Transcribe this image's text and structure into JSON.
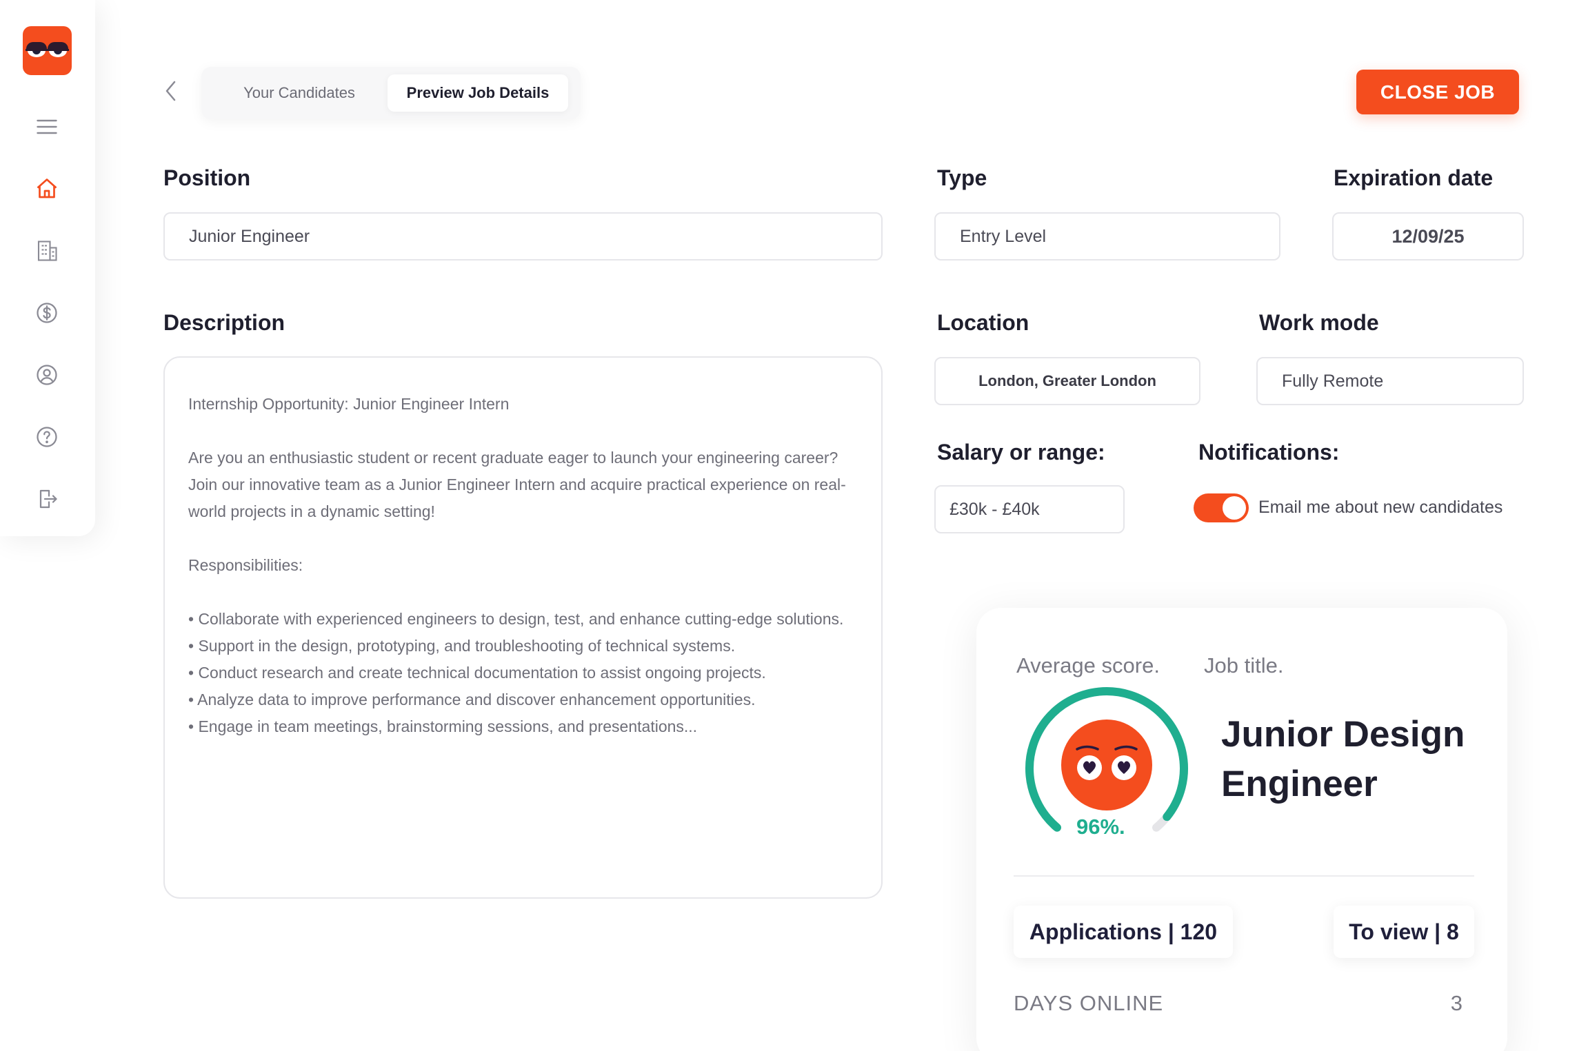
{
  "colors": {
    "accent": "#f44d1e",
    "score": "#1fae8f",
    "text": "#1f1f2e",
    "muted": "#7a7a84"
  },
  "sidebar": {
    "logo": "owl-eyes-logo",
    "items": [
      {
        "icon": "menu-icon"
      },
      {
        "icon": "home-icon",
        "active": true
      },
      {
        "icon": "building-icon"
      },
      {
        "icon": "dollar-icon"
      },
      {
        "icon": "user-circle-icon"
      },
      {
        "icon": "help-icon"
      },
      {
        "icon": "logout-icon"
      }
    ]
  },
  "header": {
    "tabs": [
      {
        "label": "Your Candidates",
        "active": false
      },
      {
        "label": "Preview Job Details",
        "active": true
      }
    ],
    "close_label": "CLOSE JOB"
  },
  "form": {
    "position": {
      "label": "Position",
      "value": "Junior Engineer"
    },
    "type": {
      "label": "Type",
      "value": "Entry Level"
    },
    "expiration": {
      "label": "Expiration date",
      "value": "12/09/25"
    },
    "description": {
      "label": "Description",
      "title": "Internship Opportunity: Junior Engineer Intern",
      "intro": "Are you an enthusiastic student or recent graduate eager to launch your engineering career? Join our innovative team as a Junior Engineer Intern and acquire practical experience on real-world projects in a dynamic setting!",
      "resp_heading": "Responsibilities:",
      "items": [
        "• Collaborate with experienced engineers to design, test, and enhance cutting-edge solutions.",
        "• Support in the design, prototyping, and troubleshooting of technical systems.",
        "• Conduct research and create technical documentation to assist ongoing projects.",
        "• Analyze data to improve performance and discover enhancement opportunities.",
        "• Engage in team meetings, brainstorming sessions, and presentations..."
      ]
    },
    "location": {
      "label": "Location",
      "value": "London, Greater London"
    },
    "work_mode": {
      "label": "Work mode",
      "value": "Fully Remote"
    },
    "salary": {
      "label": "Salary or range:",
      "value": "£30k - £40k"
    },
    "notifications": {
      "label": "Notifications:",
      "toggle_label": "Email me about new candidates",
      "enabled": true
    }
  },
  "card": {
    "avg_label": "Average score.",
    "job_label": "Job title.",
    "score": 96,
    "score_text": "96%.",
    "job_title_line1": "Junior Design",
    "job_title_line2": "Engineer",
    "applications": "Applications | 120",
    "to_view": "To view | 8",
    "days_label": "DAYS ONLINE",
    "days_value": "3"
  }
}
